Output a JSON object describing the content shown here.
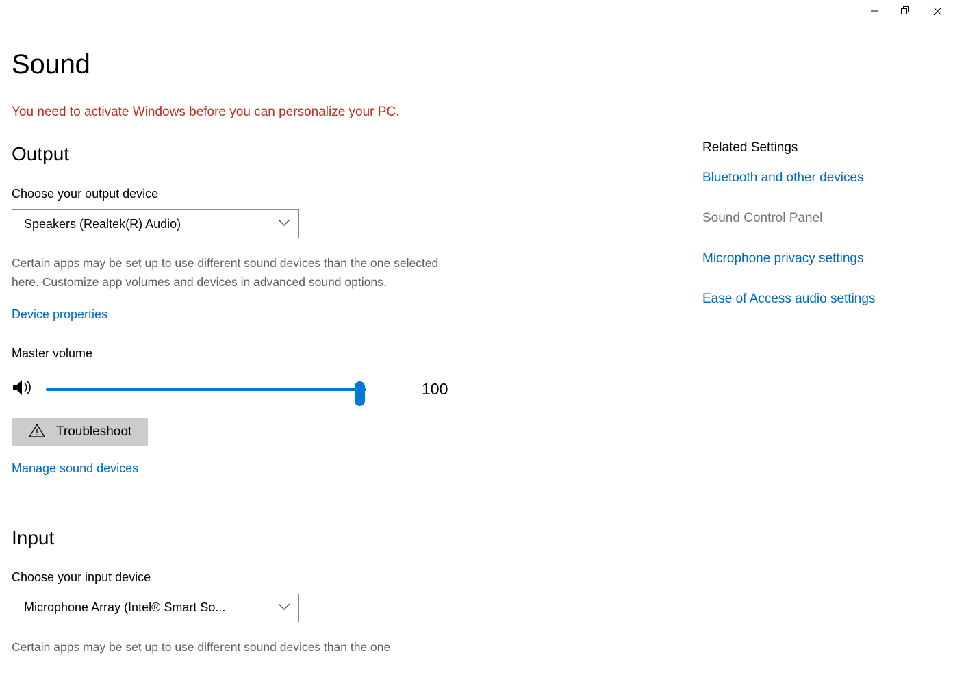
{
  "window": {
    "controls": [
      {
        "name": "minimize",
        "label": "Minimize"
      },
      {
        "name": "restore",
        "label": "Restore"
      },
      {
        "name": "close",
        "label": "Close"
      }
    ]
  },
  "page": {
    "title": "Sound",
    "activation_warning": "You need to activate Windows before you can personalize your PC."
  },
  "output": {
    "heading": "Output",
    "device_label": "Choose your output device",
    "device_value": "Speakers (Realtek(R) Audio)",
    "help_text": "Certain apps may be set up to use different sound devices than the one selected here. Customize app volumes and devices in advanced sound options.",
    "device_properties_link": "Device properties",
    "volume_label": "Master volume",
    "volume_value": "100",
    "volume_icon": "speaker-icon",
    "troubleshoot_label": "Troubleshoot",
    "troubleshoot_icon": "warning-triangle-icon",
    "manage_devices_link": "Manage sound devices"
  },
  "input": {
    "heading": "Input",
    "device_label": "Choose your input device",
    "device_value": "Microphone Array (Intel® Smart So...",
    "help_text": "Certain apps may be set up to use different sound devices than the one"
  },
  "related_settings": {
    "heading": "Related Settings",
    "items": [
      {
        "label": "Bluetooth and other devices",
        "disabled": false
      },
      {
        "label": "Sound Control Panel",
        "disabled": true
      },
      {
        "label": "Microphone privacy settings",
        "disabled": false
      },
      {
        "label": "Ease of Access audio settings",
        "disabled": false
      }
    ]
  },
  "colors": {
    "link": "#0067C0",
    "accent": "#0078D4",
    "warning_red": "#C42B1C",
    "button_gray": "#CCCCCC",
    "muted_text": "#5D5D5D"
  }
}
